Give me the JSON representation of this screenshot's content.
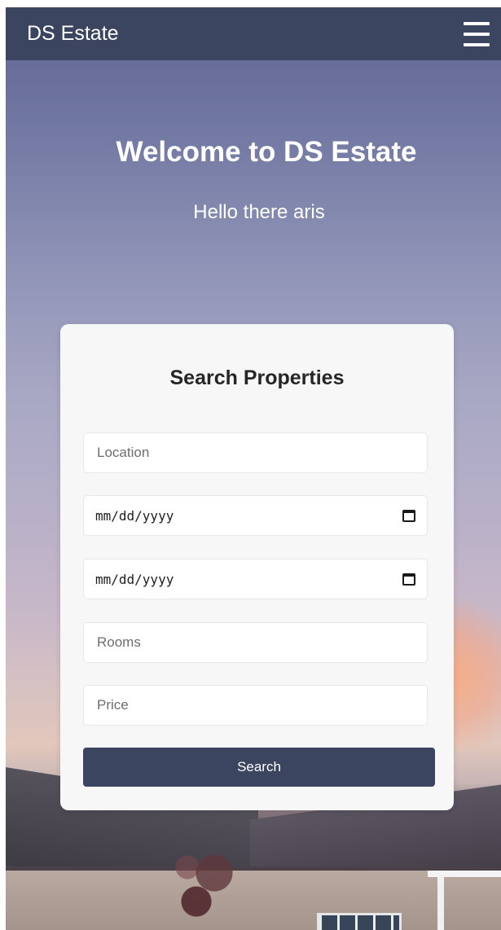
{
  "navbar": {
    "brand": "DS Estate",
    "menu_icon": "hamburger-menu-icon"
  },
  "hero": {
    "title": "Welcome to DS Estate",
    "subtitle": "Hello there aris"
  },
  "search": {
    "title": "Search Properties",
    "location_placeholder": "Location",
    "checkin_placeholder": "mm/dd/yyyy",
    "checkout_placeholder": "mm/dd/yyyy",
    "calendar_icon": "calendar-icon",
    "rooms_placeholder": "Rooms",
    "price_placeholder": "Price",
    "button_label": "Search"
  },
  "colors": {
    "navbar_bg": "#3b4560",
    "button_bg": "#3b4560",
    "card_bg": "#f7f7f7"
  }
}
